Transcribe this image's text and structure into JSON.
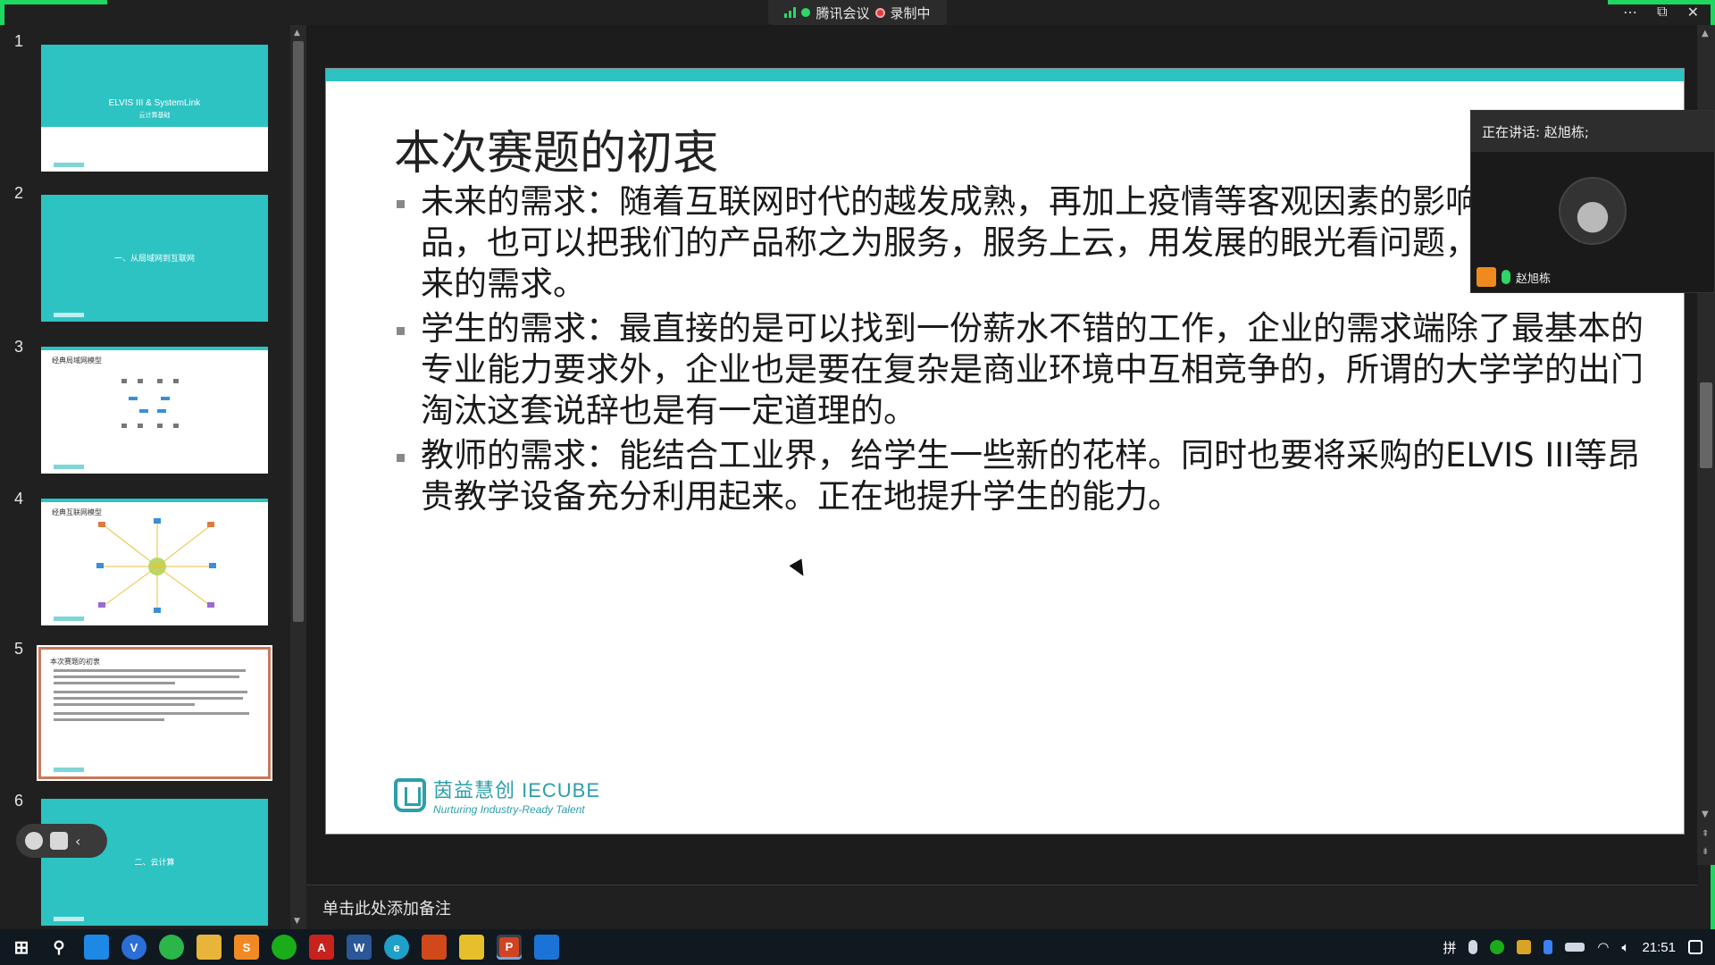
{
  "meeting_bar": {
    "app_name": "腾讯会议",
    "recording_status": "录制中"
  },
  "window_controls": [
    "more-icon",
    "restore-icon",
    "close-icon"
  ],
  "thumbnails": [
    {
      "number": "1",
      "title": "ELVIS III & SystemLink",
      "subtitle": "云计算基础",
      "style": "title-teal"
    },
    {
      "number": "2",
      "title": "一、从局域网到互联网",
      "style": "section-teal"
    },
    {
      "number": "3",
      "title": "经典局域网模型",
      "style": "diagram"
    },
    {
      "number": "4",
      "title": "经典互联网模型",
      "style": "diagram"
    },
    {
      "number": "5",
      "title": "本次赛题的初衷",
      "style": "text",
      "selected": true
    },
    {
      "number": "6",
      "title": "二、云计算",
      "style": "section-teal"
    }
  ],
  "slide": {
    "title": "本次赛题的初衷",
    "bullets": [
      "未来的需求：随着互联网时代的越发成熟，再加上疫情等客观因素的影响，我们的产品，也可以把我们的产品称之为服务，服务上云，用发展的眼光看问题，是会适应未来的需求。",
      "学生的需求：最直接的是可以找到一份薪水不错的工作，企业的需求端除了最基本的专业能力要求外，企业也是要在复杂是商业环境中互相竞争的，所谓的大学学的出门淘汰这套说辞也是有一定道理的。",
      "教师的需求：能结合工业界，给学生一些新的花样。同时也要将采购的ELVIS III等昂贵教学设备充分利用起来。正在地提升学生的能力。"
    ],
    "logo_main": "茵益慧创 IECUBE",
    "logo_sub": "Nurturing Industry-Ready Talent"
  },
  "speaker": {
    "header": "正在讲话: 赵旭栋;",
    "name": "赵旭栋"
  },
  "notes": {
    "placeholder": "单击此处添加备注"
  },
  "taskbar": {
    "apps": [
      "start",
      "search",
      "store",
      "app-v",
      "wechat-green",
      "file-explorer",
      "sublime",
      "wechat",
      "acrobat",
      "word",
      "edge",
      "matlab",
      "media",
      "powerpoint",
      "photos"
    ],
    "ime": "拼",
    "clock": "21:51"
  },
  "colors": {
    "teal": "#2dc3c3",
    "share_border": "#1ed760",
    "record_red": "#e23a3a"
  }
}
